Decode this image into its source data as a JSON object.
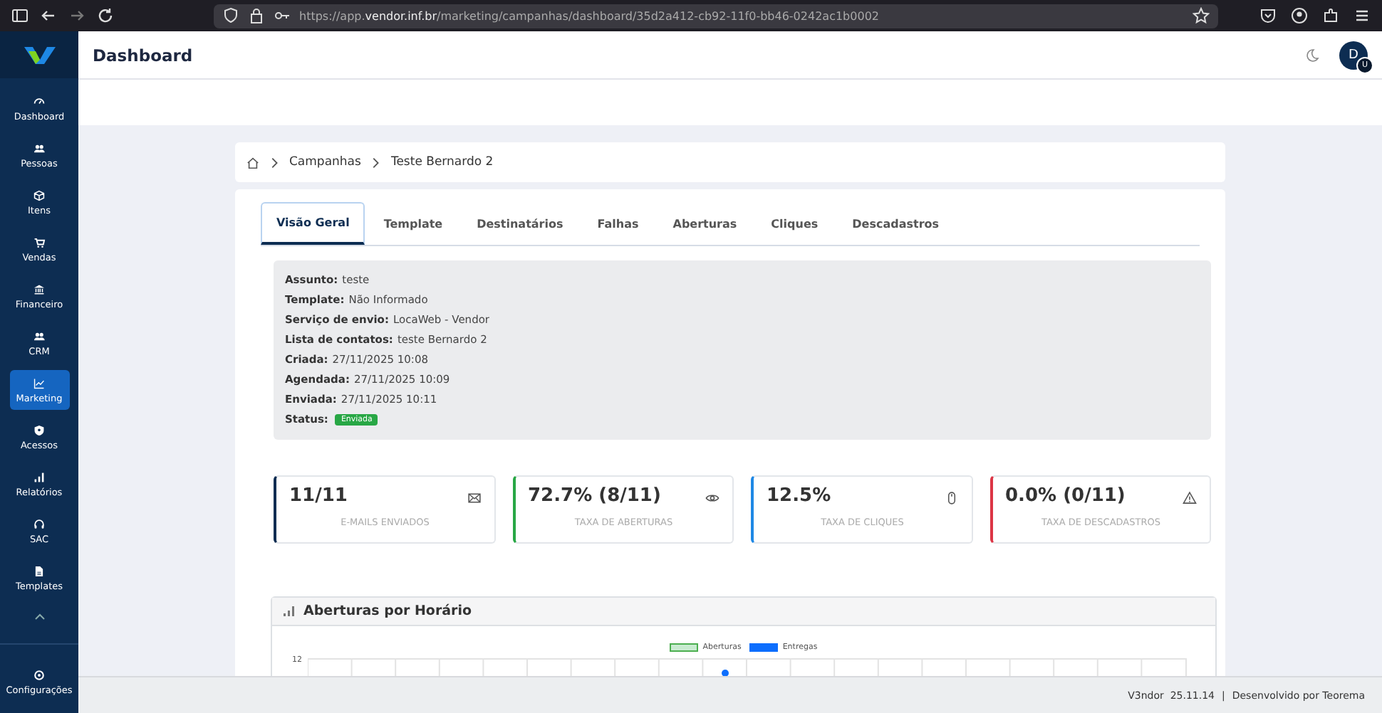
{
  "browser": {
    "url_host": "https://app.",
    "url_domain": "vendor.inf.br",
    "url_path": "/marketing/campanhas/dashboard/35d2a412-cb92-11f0-bb46-0242ac1b0002"
  },
  "header": {
    "title": "Dashboard",
    "avatar_initial": "D",
    "avatar_badge": "U"
  },
  "sidebar": {
    "items": [
      {
        "label": "Dashboard",
        "selected": false
      },
      {
        "label": "Pessoas",
        "selected": false
      },
      {
        "label": "Itens",
        "selected": false
      },
      {
        "label": "Vendas",
        "selected": false
      },
      {
        "label": "Financeiro",
        "selected": false
      },
      {
        "label": "CRM",
        "selected": false
      },
      {
        "label": "Marketing",
        "selected": true
      },
      {
        "label": "Acessos",
        "selected": false
      },
      {
        "label": "Relatórios",
        "selected": false
      },
      {
        "label": "SAC",
        "selected": false
      },
      {
        "label": "Templates",
        "selected": false
      }
    ],
    "settings": {
      "label": "Configurações"
    }
  },
  "breadcrumb": [
    "Campanhas",
    "Teste Bernardo 2"
  ],
  "tabs": [
    {
      "label": "Visão Geral",
      "selected": true
    },
    {
      "label": "Template",
      "selected": false
    },
    {
      "label": "Destinatários",
      "selected": false
    },
    {
      "label": "Falhas",
      "selected": false
    },
    {
      "label": "Aberturas",
      "selected": false
    },
    {
      "label": "Cliques",
      "selected": false
    },
    {
      "label": "Descadastros",
      "selected": false
    }
  ],
  "details": [
    {
      "label": "Assunto:",
      "value": "teste"
    },
    {
      "label": "Template:",
      "value": "Não Informado"
    },
    {
      "label": "Serviço de envio:",
      "value": "LocaWeb - Vendor"
    },
    {
      "label": "Lista de contatos:",
      "value": "teste Bernardo 2"
    },
    {
      "label": "Criada:",
      "value": "27/11/2025 10:08"
    },
    {
      "label": "Agendada:",
      "value": "27/11/2025 10:09"
    },
    {
      "label": "Enviada:",
      "value": "27/11/2025 10:11"
    },
    {
      "label": "Status:",
      "badge": "Enviada"
    }
  ],
  "stats": [
    {
      "value": "11/11",
      "label": "E-MAILS ENVIADOS",
      "color": "#0d2d52"
    },
    {
      "value": "72.7% (8/11)",
      "label": "TAXA DE ABERTURAS",
      "color": "#28a745"
    },
    {
      "value": "12.5%",
      "label": "TAXA DE CLIQUES",
      "color": "#1e88e5"
    },
    {
      "value": "0.0% (0/11)",
      "label": "TAXA DE DESCADASTROS",
      "color": "#dc3545"
    }
  ],
  "chart_panel": {
    "title": "Aberturas por Horário",
    "legend": [
      {
        "label": "Aberturas",
        "color": "#c8ebd0"
      },
      {
        "label": "Entregas",
        "color": "#0d6efd"
      }
    ],
    "y_tick": "12"
  },
  "footer": {
    "version": "V3ndor  25.11.14",
    "separator": "|",
    "credit": "Desenvolvido por Teorema"
  }
}
